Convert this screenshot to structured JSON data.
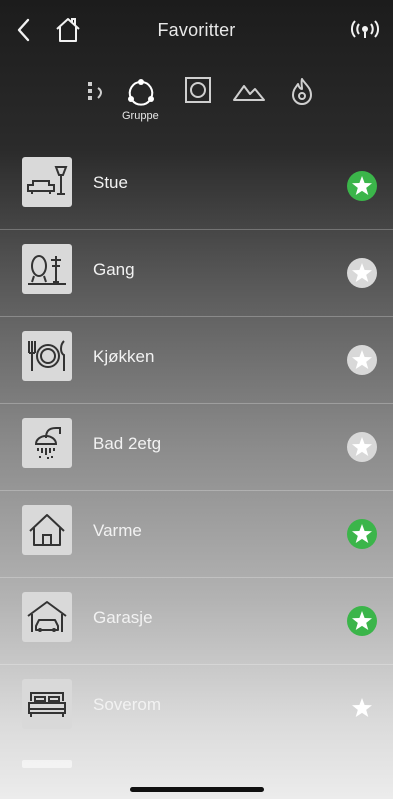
{
  "header": {
    "title": "Favoritter"
  },
  "filters": {
    "active_label": "Gruppe"
  },
  "rooms": [
    {
      "label": "Stue",
      "favorite": true
    },
    {
      "label": "Gang",
      "favorite": false
    },
    {
      "label": "Kjøkken",
      "favorite": false
    },
    {
      "label": "Bad 2etg",
      "favorite": false
    },
    {
      "label": "Varme",
      "favorite": true
    },
    {
      "label": "Garasje",
      "favorite": true
    },
    {
      "label": "Soverom",
      "favorite": false
    }
  ],
  "colors": {
    "favorite": "#3bb54a",
    "not_favorite": "#d8d8d8",
    "title": "#e8e8e8"
  },
  "icons": {
    "header": [
      "chevron-left-icon",
      "home-icon",
      "signal-icon"
    ],
    "filters": [
      "device-icon",
      "group-icon",
      "room-square-icon",
      "mountain-icon",
      "fire-icon"
    ],
    "rooms": [
      "living-room-icon",
      "hallway-icon",
      "kitchen-icon",
      "shower-icon",
      "house-icon",
      "garage-icon",
      "bed-icon"
    ]
  }
}
